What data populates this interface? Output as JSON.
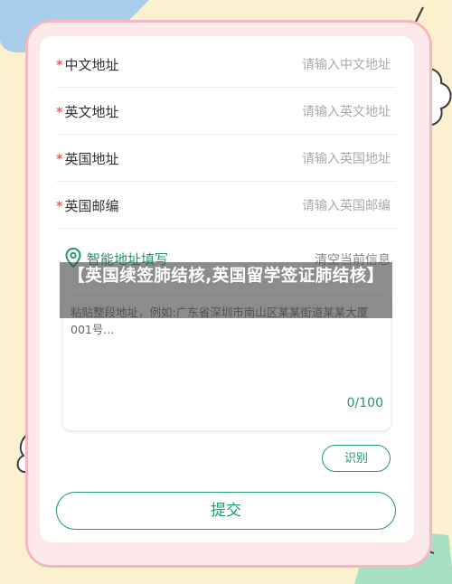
{
  "form": {
    "fields": [
      {
        "required_mark": "*",
        "label": "中文地址",
        "placeholder": "请输入中文地址"
      },
      {
        "required_mark": "*",
        "label": "英文地址",
        "placeholder": "请输入英文地址"
      },
      {
        "required_mark": "*",
        "label": "英国地址",
        "placeholder": "请输入英国地址"
      },
      {
        "required_mark": "*",
        "label": "英国邮编",
        "placeholder": "请输入英国邮编"
      }
    ]
  },
  "smart_fill": {
    "title": "智能地址填写",
    "clear_label": "清空当前信息",
    "textarea_placeholder": "粘贴整段地址，例如:广东省深圳市南山区某某街道某某大厦001号...",
    "counter": "0/100",
    "recognize_label": "识别"
  },
  "submit_label": "提交",
  "overlay_caption": "【英国续签肺结核,英国留学签证肺结核】",
  "colors": {
    "accent": "#1f9a6a",
    "required": "#e3342f",
    "background": "#fbf1cf",
    "frame": "#f4b8c4"
  }
}
